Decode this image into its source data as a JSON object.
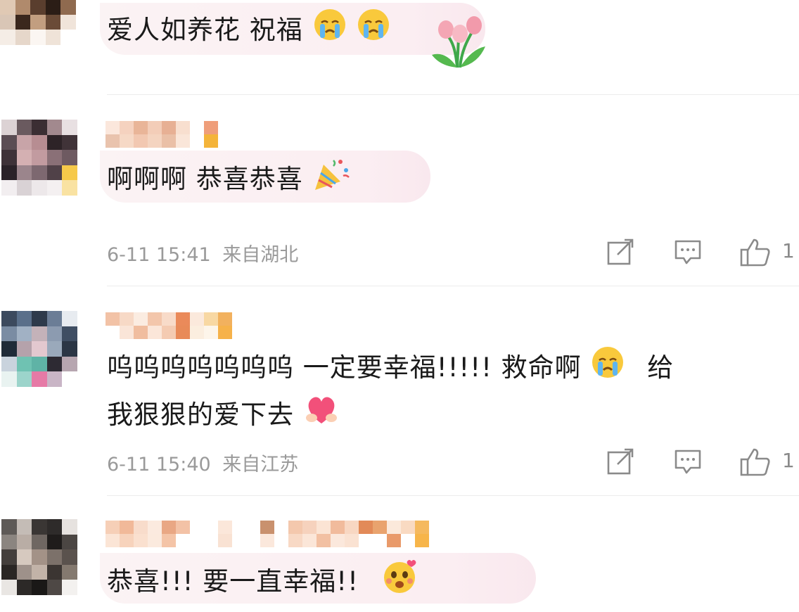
{
  "comments": [
    {
      "text": "爱人如养花 祝福",
      "emojis": [
        "crying-emoji",
        "crying-emoji",
        "tulip-flowers-emoji"
      ]
    },
    {
      "text": "啊啊啊 恭喜恭喜",
      "emojis": [
        "party-popper-emoji"
      ],
      "time": "6-11 15:41",
      "location": "来自湖北",
      "likes": "1"
    },
    {
      "text_line1": "呜呜呜呜呜呜呜  一定要幸福!!!!!  救命啊",
      "text_line1_tail": "给",
      "text_line2": "我狠狠的爱下去",
      "emojis": [
        "crying-emoji",
        "heart-hands-emoji"
      ],
      "time": "6-11 15:40",
      "location": "来自江苏",
      "likes": "1"
    },
    {
      "text": "恭喜!!!  要一直幸福!!",
      "emojis": [
        "shy-smile-emoji"
      ]
    }
  ],
  "icons": {
    "share": "share-icon",
    "reply": "comment-icon",
    "like": "thumbs-up-icon"
  },
  "colors": {
    "bubble": "#fbf0f3",
    "meta": "#9a9a9a",
    "divider": "#ececec"
  }
}
